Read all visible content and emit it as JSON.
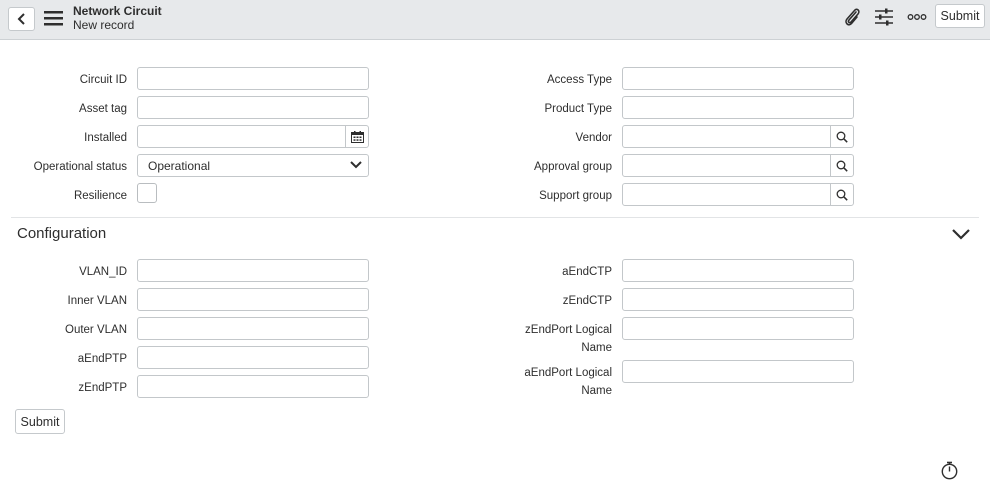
{
  "header": {
    "title": "Network Circuit",
    "subtitle": "New record",
    "submit_label": "Submit",
    "icons": [
      "back-icon",
      "menu-icon",
      "attachment-icon",
      "settings-sliders-icon",
      "more-options-icon"
    ]
  },
  "form": {
    "left": [
      {
        "label": "Circuit ID",
        "value": ""
      },
      {
        "label": "Asset tag",
        "value": ""
      },
      {
        "label": "Installed",
        "value": ""
      },
      {
        "label": "Operational status",
        "value": "Operational"
      },
      {
        "label": "Resilience",
        "checked": false
      }
    ],
    "right": [
      {
        "label": "Access Type",
        "value": ""
      },
      {
        "label": "Product Type",
        "value": ""
      },
      {
        "label": "Vendor",
        "value": ""
      },
      {
        "label": "Approval group",
        "value": ""
      },
      {
        "label": "Support group",
        "value": ""
      }
    ]
  },
  "configuration": {
    "title": "Configuration",
    "left": [
      {
        "label": "VLAN_ID",
        "value": ""
      },
      {
        "label": "Inner VLAN",
        "value": ""
      },
      {
        "label": "Outer VLAN",
        "value": ""
      },
      {
        "label": "aEndPTP",
        "value": ""
      },
      {
        "label": "zEndPTP",
        "value": ""
      }
    ],
    "right": [
      {
        "label": "aEndCTP",
        "value": ""
      },
      {
        "label": "zEndCTP",
        "value": ""
      },
      {
        "label_line1": "zEndPort Logical",
        "label_line2": "Name",
        "value": ""
      },
      {
        "label_line1": "aEndPort Logical",
        "label_line2": "Name",
        "value": ""
      }
    ]
  },
  "footer": {
    "submit_label": "Submit"
  }
}
